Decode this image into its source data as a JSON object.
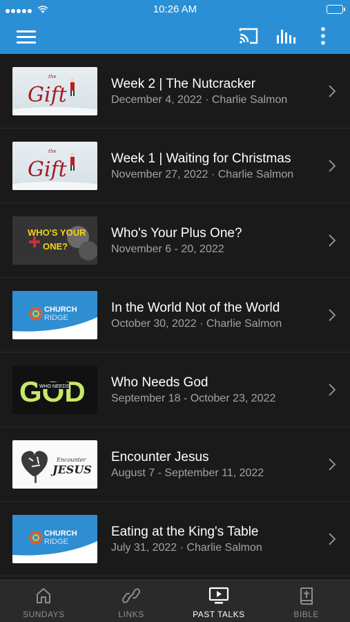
{
  "status_bar": {
    "time": "10:26 AM"
  },
  "colors": {
    "accent": "#2b8fd6",
    "background": "#1a1a1b",
    "subtitle": "#a3a3a5"
  },
  "app_bar": {
    "icons": [
      "menu-icon",
      "cast-icon",
      "audio-bars-icon",
      "more-vert-icon"
    ]
  },
  "talks": [
    {
      "title": "Week 2 | The Nutcracker",
      "subtitle": "December 4, 2022 · Charlie Salmon",
      "thumb_text": "Gift",
      "thumb_small": "the"
    },
    {
      "title": "Week 1 | Waiting for Christmas",
      "subtitle": "November 27, 2022 · Charlie Salmon",
      "thumb_text": "Gift",
      "thumb_small": "the"
    },
    {
      "title": "Who's Your Plus One?",
      "subtitle": "November 6 - 20, 2022",
      "thumb_text_1": "WHO'S YOUR",
      "thumb_text_2": "ONE?"
    },
    {
      "title": "In the World Not of the World",
      "subtitle": "October 30, 2022 · Charlie Salmon",
      "thumb_text_1": "CHURCH",
      "thumb_text_2": "RIDGE"
    },
    {
      "title": "Who Needs God",
      "subtitle": "September 18 - October 23, 2022",
      "thumb_text_1": "GOD",
      "thumb_text_2": "WHO NEEDS"
    },
    {
      "title": "Encounter Jesus",
      "subtitle": "August 7 - September 11, 2022",
      "thumb_text_1": "Encounter",
      "thumb_text_2": "JESUS"
    },
    {
      "title": "Eating at the King's Table",
      "subtitle": "July 31, 2022 · Charlie Salmon",
      "thumb_text_1": "CHURCH",
      "thumb_text_2": "RIDGE"
    }
  ],
  "tabs": [
    {
      "label": "SUNDAYS",
      "icon": "home-icon",
      "active": false
    },
    {
      "label": "LINKS",
      "icon": "link-icon",
      "active": false
    },
    {
      "label": "PAST TALKS",
      "icon": "tv-play-icon",
      "active": true
    },
    {
      "label": "BIBLE",
      "icon": "bible-icon",
      "active": false
    }
  ]
}
